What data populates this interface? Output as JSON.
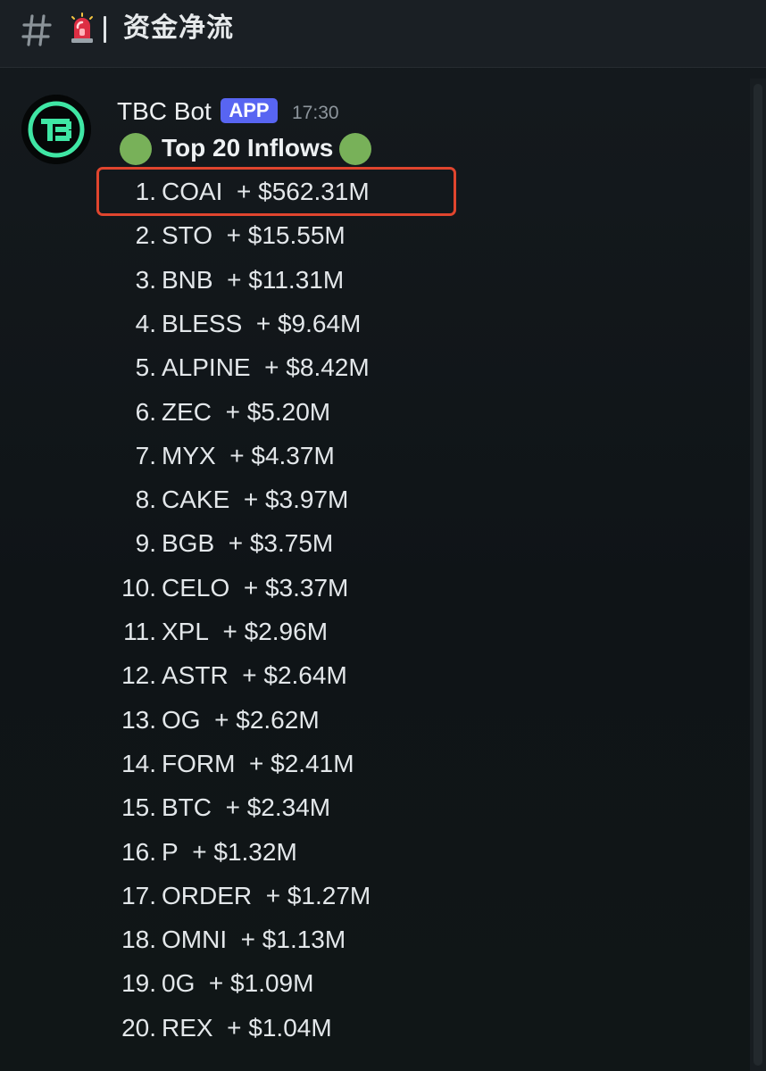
{
  "header": {
    "channel_name": "资金净流",
    "hash_icon": "hash-icon",
    "siren_icon": "rotating-light-icon"
  },
  "message": {
    "author": "TBC Bot",
    "badge": "APP",
    "timestamp": "17:30",
    "title": "Top 20 Inflows",
    "title_emoji": "green-circle-icon",
    "accent_color": "#5865f2",
    "highlight_color": "#e0452e",
    "items": [
      {
        "rank": "1.",
        "symbol": "COAI",
        "amount": "+ $562.31M"
      },
      {
        "rank": "2.",
        "symbol": "STO",
        "amount": "+ $15.55M"
      },
      {
        "rank": "3.",
        "symbol": "BNB",
        "amount": "+ $11.31M"
      },
      {
        "rank": "4.",
        "symbol": "BLESS",
        "amount": "+ $9.64M"
      },
      {
        "rank": "5.",
        "symbol": "ALPINE",
        "amount": "+ $8.42M"
      },
      {
        "rank": "6.",
        "symbol": "ZEC",
        "amount": "+ $5.20M"
      },
      {
        "rank": "7.",
        "symbol": "MYX",
        "amount": "+ $4.37M"
      },
      {
        "rank": "8.",
        "symbol": "CAKE",
        "amount": "+ $3.97M"
      },
      {
        "rank": "9.",
        "symbol": "BGB",
        "amount": "+ $3.75M"
      },
      {
        "rank": "10.",
        "symbol": "CELO",
        "amount": "+ $3.37M"
      },
      {
        "rank": "11.",
        "symbol": "XPL",
        "amount": "+ $2.96M"
      },
      {
        "rank": "12.",
        "symbol": "ASTR",
        "amount": "+ $2.64M"
      },
      {
        "rank": "13.",
        "symbol": "OG",
        "amount": "+ $2.62M"
      },
      {
        "rank": "14.",
        "symbol": "FORM",
        "amount": "+ $2.41M"
      },
      {
        "rank": "15.",
        "symbol": "BTC",
        "amount": "+ $2.34M"
      },
      {
        "rank": "16.",
        "symbol": "P",
        "amount": "+ $1.32M"
      },
      {
        "rank": "17.",
        "symbol": "ORDER",
        "amount": "+ $1.27M"
      },
      {
        "rank": "18.",
        "symbol": "OMNI",
        "amount": "+ $1.13M"
      },
      {
        "rank": "19.",
        "symbol": "0G",
        "amount": "+ $1.09M"
      },
      {
        "rank": "20.",
        "symbol": "REX",
        "amount": "+ $1.04M"
      }
    ]
  }
}
